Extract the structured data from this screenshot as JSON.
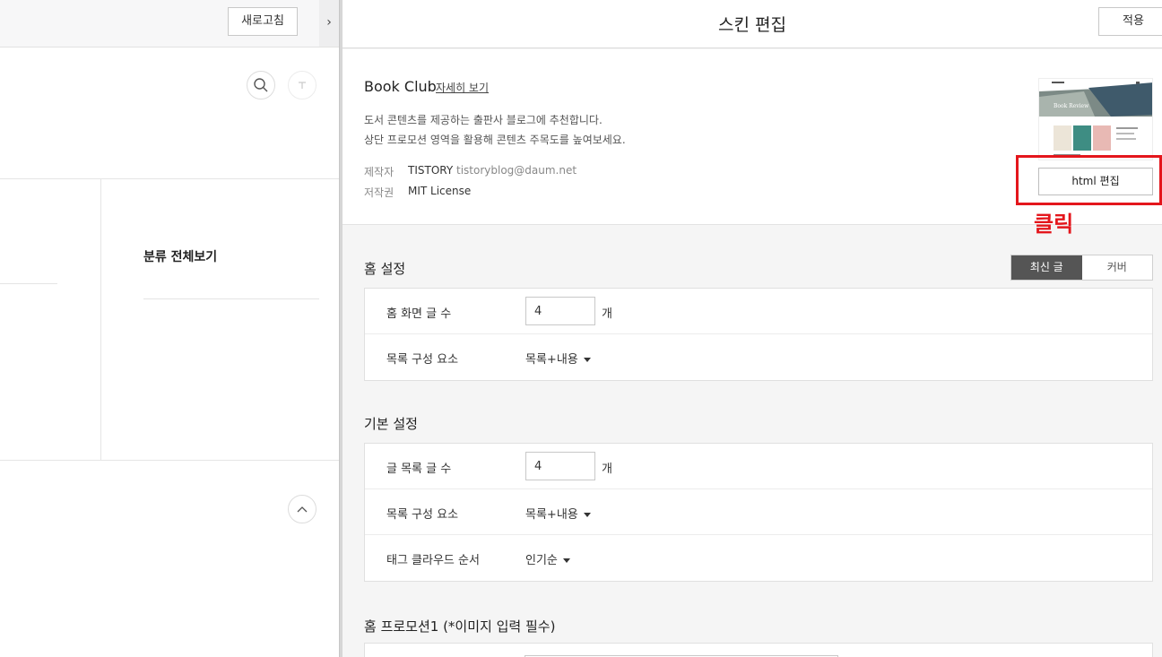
{
  "left_panel": {
    "refresh_label": "새로고침",
    "collapse_glyph": "›",
    "category_all": "분류 전체보기"
  },
  "header": {
    "title": "스킨 편집",
    "apply_label": "적용"
  },
  "skin": {
    "name": "Book Club",
    "detail_link": "자세히 보기",
    "description_1": "도서 콘텐츠를 제공하는 출판사 블로그에 추천합니다.",
    "description_2": "상단 프로모션 영역을 활용해 콘텐츠 주목도를 높여보세요.",
    "maker_label": "제작자",
    "maker_name": "TISTORY",
    "maker_email": "tistoryblog@daum.net",
    "license_label": "저작권",
    "license_value": "MIT License",
    "thumbnail_title": "Book Review",
    "html_edit_label": "html 편집"
  },
  "annotation": {
    "note": "클릭",
    "color": "#e4161c"
  },
  "home_settings": {
    "title": "홈 설정",
    "toggle_latest": "최신 글",
    "toggle_cover": "커버",
    "post_count_label": "홈 화면 글 수",
    "post_count_value": "4",
    "post_count_unit": "개",
    "list_elements_label": "목록 구성 요소",
    "list_elements_value": "목록+내용"
  },
  "basic_settings": {
    "title": "기본 설정",
    "post_list_count_label": "글 목록 글 수",
    "post_list_count_value": "4",
    "post_list_count_unit": "개",
    "list_elements_label": "목록 구성 요소",
    "list_elements_value": "목록+내용",
    "tag_cloud_label": "태그 클라우드 순서",
    "tag_cloud_value": "인기순"
  },
  "promotion": {
    "title": "홈 프로모션1 (*이미지 입력 필수)"
  }
}
